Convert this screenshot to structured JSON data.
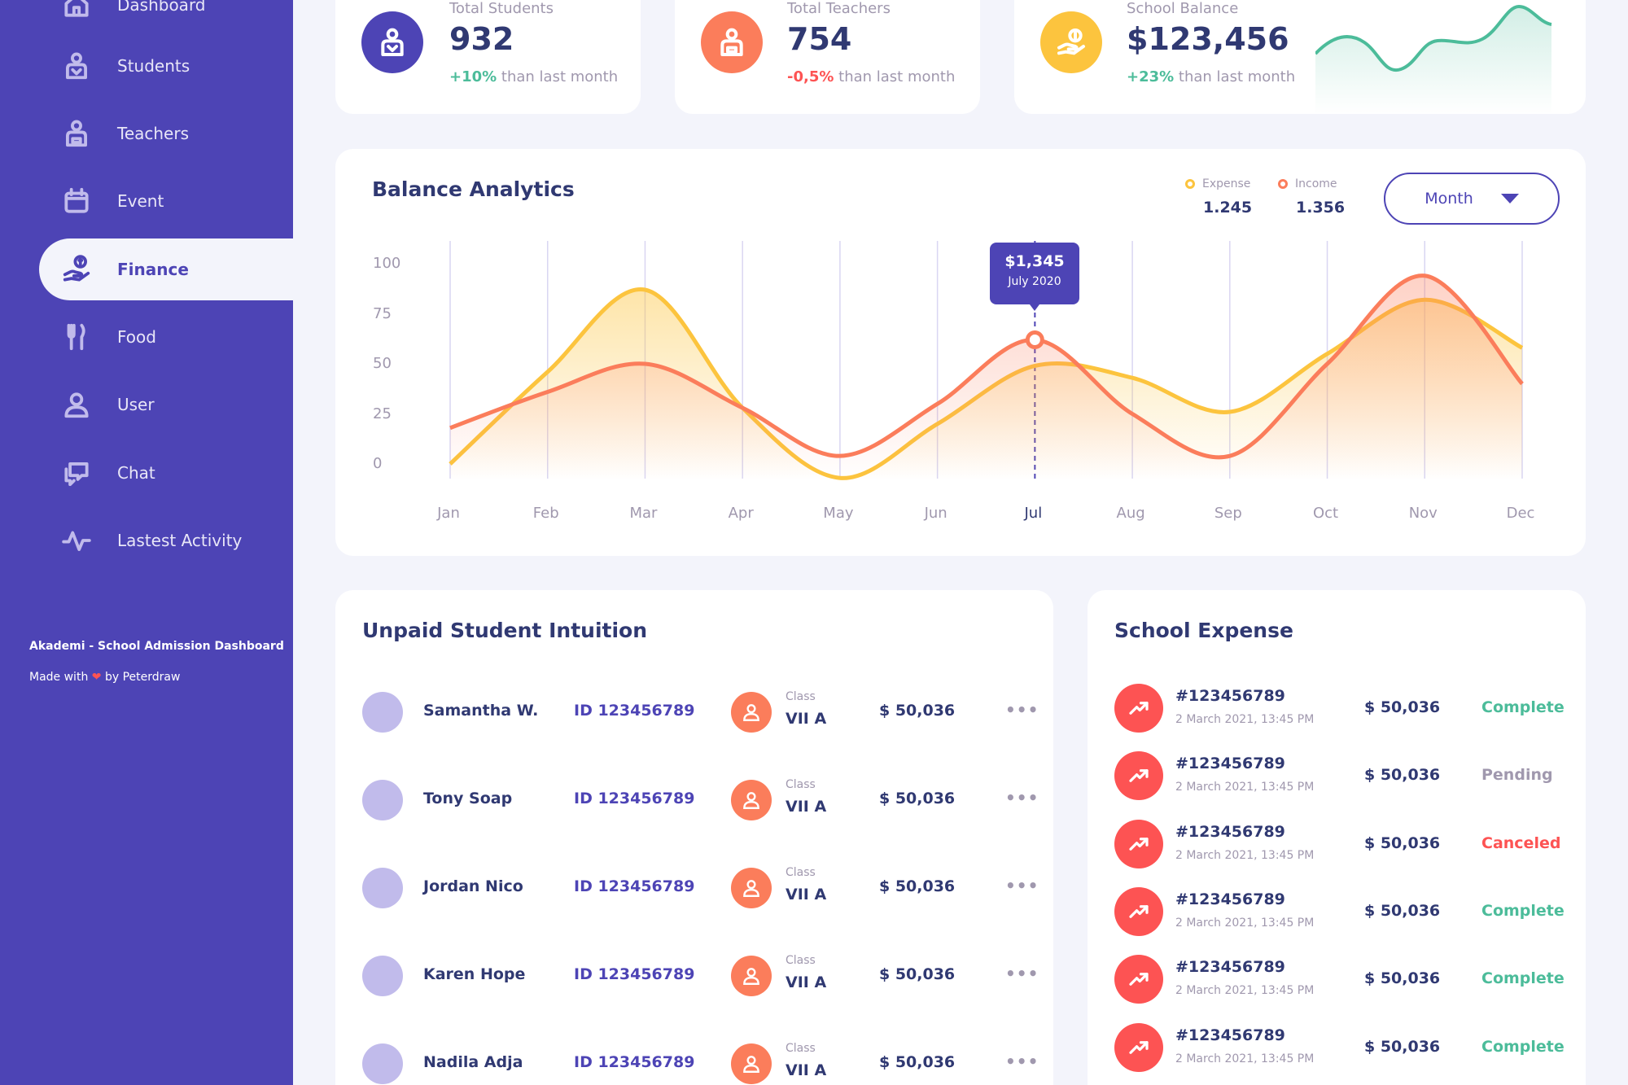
{
  "sidebar": {
    "items": [
      {
        "label": "Dashboard",
        "icon": "home-icon"
      },
      {
        "label": "Students",
        "icon": "student-icon"
      },
      {
        "label": "Teachers",
        "icon": "teacher-icon"
      },
      {
        "label": "Event",
        "icon": "calendar-icon"
      },
      {
        "label": "Finance",
        "icon": "finance-icon",
        "active": true
      },
      {
        "label": "Food",
        "icon": "food-icon"
      },
      {
        "label": "User",
        "icon": "user-icon"
      },
      {
        "label": "Chat",
        "icon": "chat-icon"
      },
      {
        "label": "Lastest Activity",
        "icon": "activity-icon"
      }
    ],
    "brand": "Akademi - School Admission Dashboard",
    "made_with_prefix": "Made with",
    "made_with_heart": "❤",
    "made_with_suffix": "by Peterdraw"
  },
  "stats": [
    {
      "label": "Total Students",
      "value": "932",
      "change": "+10%",
      "change_suffix": "than last month",
      "trend": "up",
      "color": "#4d44b5",
      "icon": "student-icon"
    },
    {
      "label": "Total Teachers",
      "value": "754",
      "change": "-0,5%",
      "change_suffix": "than last month",
      "trend": "down",
      "color": "#fb7d5b",
      "icon": "teacher-icon"
    },
    {
      "label": "School Balance",
      "value": "$123,456",
      "change": "+23%",
      "change_suffix": "than last month",
      "trend": "up",
      "color": "#fcc43e",
      "icon": "money-hand-icon"
    }
  ],
  "balance": {
    "title": "Balance Analytics",
    "legend": [
      {
        "label": "Expense",
        "value": "1.245",
        "color": "#fcc43e"
      },
      {
        "label": "Income",
        "value": "1.356",
        "color": "#fb7d5b"
      }
    ],
    "period_select": "Month",
    "tooltip": {
      "value": "$1,345",
      "date": "July 2020"
    },
    "selected_month": "Jul"
  },
  "chart_data": {
    "type": "area",
    "categories": [
      "Jan",
      "Feb",
      "Mar",
      "Apr",
      "May",
      "Jun",
      "Jul",
      "Aug",
      "Sep",
      "Oct",
      "Nov",
      "Dec"
    ],
    "y_ticks": [
      "100",
      "75",
      "50",
      "25",
      "0"
    ],
    "ylim": [
      0,
      100
    ],
    "series": [
      {
        "name": "Expense",
        "color": "#fcc43e",
        "values": [
          0,
          46,
          87,
          28,
          -7,
          20,
          49,
          43,
          26,
          55,
          82,
          58
        ]
      },
      {
        "name": "Income",
        "color": "#fb7d5b",
        "values": [
          18,
          36,
          50,
          28,
          4,
          30,
          62,
          25,
          4,
          50,
          94,
          40
        ]
      }
    ],
    "grid": true,
    "legend_position": "top-right"
  },
  "unpaid": {
    "title": "Unpaid Student Intuition",
    "class_label": "Class",
    "rows": [
      {
        "name": "Samantha W.",
        "id": "ID 123456789",
        "class": "VII A",
        "amount": "$ 50,036"
      },
      {
        "name": "Tony Soap",
        "id": "ID 123456789",
        "class": "VII A",
        "amount": "$ 50,036"
      },
      {
        "name": "Jordan Nico",
        "id": "ID 123456789",
        "class": "VII A",
        "amount": "$ 50,036"
      },
      {
        "name": "Karen Hope",
        "id": "ID 123456789",
        "class": "VII A",
        "amount": "$ 50,036"
      },
      {
        "name": "Nadila Adja",
        "id": "ID 123456789",
        "class": "VII A",
        "amount": "$ 50,036"
      }
    ],
    "more_glyph": "•••"
  },
  "expense": {
    "title": "School Expense",
    "rows": [
      {
        "id": "#123456789",
        "date": "2 March 2021, 13:45 PM",
        "amount": "$ 50,036",
        "status": "Complete",
        "status_color": "#4cbc9a"
      },
      {
        "id": "#123456789",
        "date": "2 March 2021, 13:45 PM",
        "amount": "$ 50,036",
        "status": "Pending",
        "status_color": "#a098ae"
      },
      {
        "id": "#123456789",
        "date": "2 March 2021, 13:45 PM",
        "amount": "$ 50,036",
        "status": "Canceled",
        "status_color": "#fd5353"
      },
      {
        "id": "#123456789",
        "date": "2 March 2021, 13:45 PM",
        "amount": "$ 50,036",
        "status": "Complete",
        "status_color": "#4cbc9a"
      },
      {
        "id": "#123456789",
        "date": "2 March 2021, 13:45 PM",
        "amount": "$ 50,036",
        "status": "Complete",
        "status_color": "#4cbc9a"
      },
      {
        "id": "#123456789",
        "date": "2 March 2021, 13:45 PM",
        "amount": "$ 50,036",
        "status": "Complete",
        "status_color": "#4cbc9a"
      }
    ]
  }
}
